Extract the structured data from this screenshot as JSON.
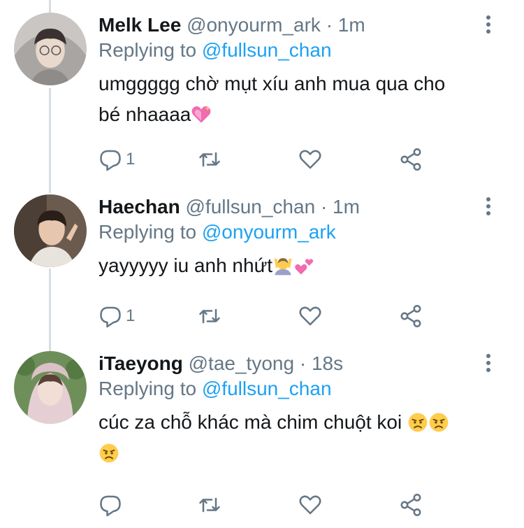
{
  "replying_label": "Replying to",
  "tweets": [
    {
      "name": "Melk Lee",
      "handle": "@onyourm_ark",
      "time": "1m",
      "reply_to": "@fullsun_chan",
      "text_1": "umggggg chờ mụt xíu anh mua qua cho",
      "text_2": "bé nhaaaa",
      "emoji_after": "sparkling-heart",
      "reply_count": "1"
    },
    {
      "name": "Haechan",
      "handle": "@fullsun_chan",
      "time": "1m",
      "reply_to": "@onyourm_ark",
      "text_1": "yayyyyy iu anh nhứt",
      "emoji_after": [
        "person-raising-hands",
        "two-hearts"
      ],
      "reply_count": "1"
    },
    {
      "name": "iTaeyong",
      "handle": "@tae_tyong",
      "time": "18s",
      "reply_to": "@fullsun_chan",
      "text_1": "cúc za chỗ khác mà chim chuột koi",
      "emoji_after": [
        "angry-face",
        "angry-face",
        "angry-face"
      ],
      "reply_count": ""
    }
  ],
  "colors": {
    "link": "#1da1f2",
    "secondary": "#657786",
    "thread_line": "#d6dde3"
  }
}
